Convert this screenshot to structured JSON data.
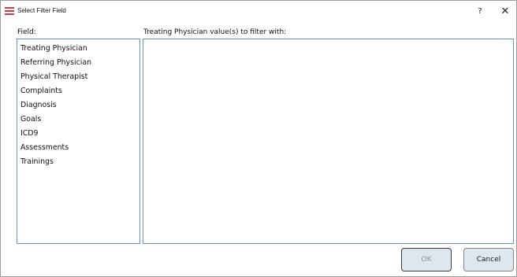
{
  "window": {
    "title": "Select Filter Field",
    "help_glyph": "?",
    "close_glyph": "✕",
    "icon_color": "#d9363e"
  },
  "fields": {
    "label": "Field:",
    "items": [
      "Treating Physician",
      "Referring Physician",
      "Physical Therapist",
      "Complaints",
      "Diagnosis",
      "Goals",
      "ICD9",
      "Assessments",
      "Trainings"
    ]
  },
  "values": {
    "label": "Treating Physician value(s) to filter with:",
    "items": []
  },
  "buttons": {
    "ok_label": "OK",
    "cancel_label": "Cancel"
  }
}
